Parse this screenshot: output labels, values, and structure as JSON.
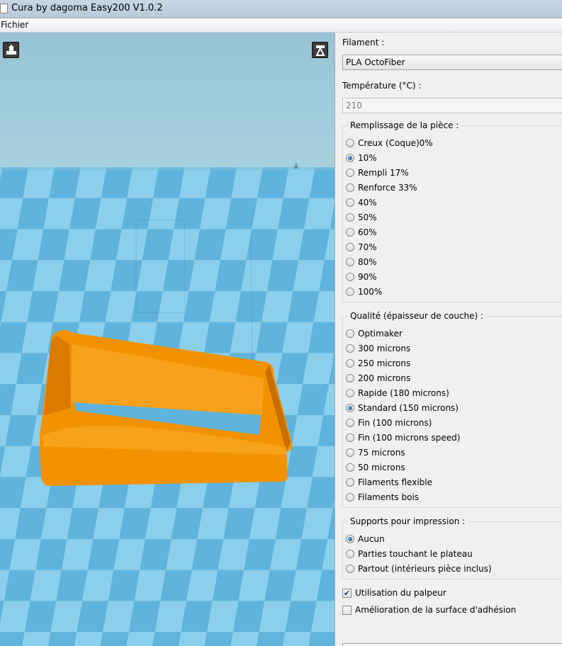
{
  "window": {
    "title": "Cura by dagoma Easy200 V1.0.2"
  },
  "menu": {
    "items": [
      "Fichier"
    ]
  },
  "viewport": {
    "colors": {
      "sky": "#9ec9d8",
      "floor_dark": "#5fb3dc",
      "floor_light": "#8ccfec",
      "model": "#f39200"
    }
  },
  "filament": {
    "label": "Filament :",
    "value": "PLA OctoFiber"
  },
  "temperature": {
    "label": "Température (°C) :",
    "value": "210"
  },
  "infill": {
    "title": "Remplissage de la pièce :",
    "selected": 1,
    "options": [
      "Creux (Coque)0%",
      "10%",
      "Rempli 17%",
      "Renforce 33%",
      "40%",
      "50%",
      "60%",
      "70%",
      "80%",
      "90%",
      "100%"
    ]
  },
  "quality": {
    "title": "Qualité (épaisseur de couche) :",
    "selected": 5,
    "options": [
      "Optimaker",
      "300 microns",
      "250 microns",
      "200 microns",
      "Rapide (180 microns)",
      "Standard (150 microns)",
      "Fin (100 microns)",
      "Fin (100 microns speed)",
      "75 microns",
      "50 microns",
      "Filaments flexible",
      "Filaments bois"
    ]
  },
  "supports": {
    "title": "Supports pour impression :",
    "selected": 0,
    "options": [
      "Aucun",
      "Parties touchant le plateau",
      "Partout (intérieurs pièce inclus)"
    ]
  },
  "checks": [
    {
      "label": "Utilisation du palpeur",
      "checked": true
    },
    {
      "label": "Amélioration de la surface d'adhésion",
      "checked": false
    }
  ]
}
